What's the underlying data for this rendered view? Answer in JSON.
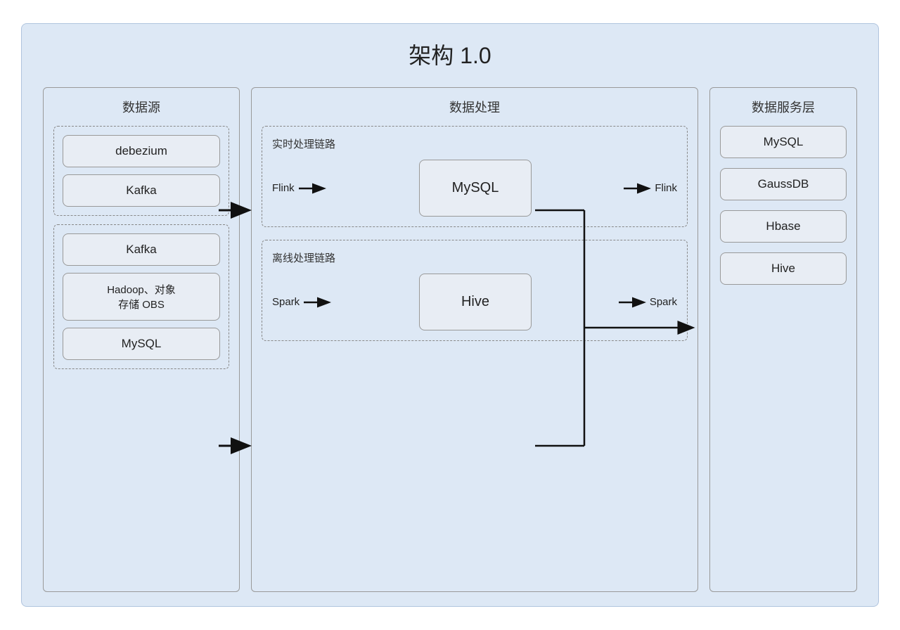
{
  "title": "架构 1.0",
  "left": {
    "label": "数据源",
    "group1": {
      "items": [
        "debezium",
        "Kafka"
      ]
    },
    "group2": {
      "items": [
        "Kafka",
        "Hadoop、对象\n存储 OBS",
        "MySQL"
      ]
    }
  },
  "mid": {
    "label": "数据处理",
    "realtime": {
      "label": "实时处理链路",
      "arrow_in": "Flink",
      "component": "MySQL",
      "arrow_out": "Flink"
    },
    "offline": {
      "label": "离线处理链路",
      "arrow_in": "Spark",
      "component": "Hive",
      "arrow_out": "Spark"
    }
  },
  "right": {
    "label": "数据服务层",
    "items": [
      "MySQL",
      "GaussDB",
      "Hbase",
      "Hive"
    ]
  },
  "colors": {
    "bg": "#dde8f5",
    "comp_bg": "#e8edf4",
    "border": "#999"
  }
}
